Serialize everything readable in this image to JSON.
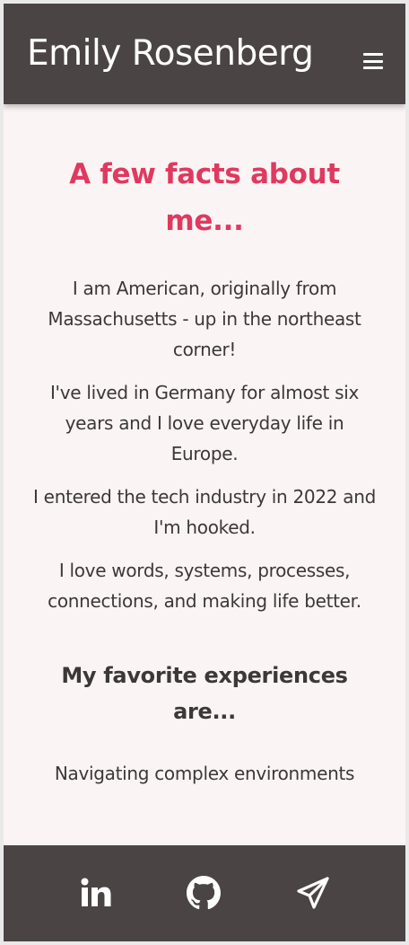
{
  "header": {
    "title": "Emily Rosenberg",
    "menu_icon": "hamburger-menu-icon"
  },
  "main": {
    "heading": "A few facts about me...",
    "facts": [
      "I am American, originally from Massachusetts - up in the northeast corner!",
      "I've lived in Germany for almost six years and I love everyday life in Europe.",
      "I entered the tech industry in 2022 and I'm hooked.",
      "I love words, systems, processes, connections, and making life better."
    ],
    "experiences_heading": "My favorite experiences are...",
    "experiences": [
      "Navigating complex environments"
    ]
  },
  "footer": {
    "links": [
      {
        "icon": "linkedin-icon"
      },
      {
        "icon": "github-icon"
      },
      {
        "icon": "paper-plane-icon"
      }
    ]
  },
  "colors": {
    "header_bg": "#4a4445",
    "page_bg": "#fbf4f5",
    "accent": "#e0395f",
    "text": "#3c3838"
  }
}
